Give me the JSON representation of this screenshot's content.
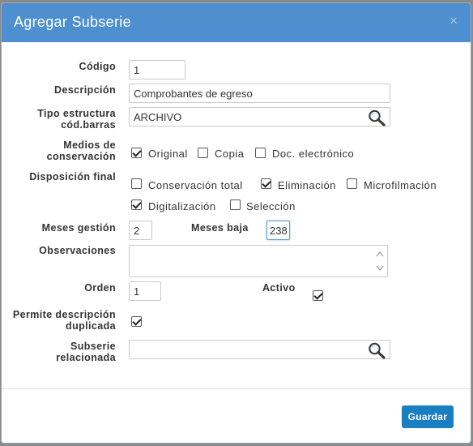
{
  "modal": {
    "title": "Agregar Subserie",
    "close_label": "×"
  },
  "fields": {
    "codigo": {
      "label": "Código",
      "value": "1"
    },
    "descripcion": {
      "label": "Descripción",
      "value": "Comprobantes de egreso"
    },
    "tipo_estructura": {
      "label_line1": "Tipo estructura",
      "label_line2": "cód.barras",
      "value": "ARCHIVO"
    },
    "medios": {
      "label_line1": "Medios de",
      "label_line2": "conservación",
      "options": [
        {
          "label": "Original",
          "checked": true
        },
        {
          "label": "Copia",
          "checked": false
        },
        {
          "label": "Doc. electrónico",
          "checked": false
        }
      ]
    },
    "disposicion": {
      "label": "Disposición final",
      "options": [
        {
          "label": "Conservación total",
          "checked": false
        },
        {
          "label": "Eliminación",
          "checked": true
        },
        {
          "label": "Microfilmación",
          "checked": false
        },
        {
          "label": "Digitalización",
          "checked": true
        },
        {
          "label": "Selección",
          "checked": false
        }
      ]
    },
    "meses_gestion": {
      "label": "Meses gestión",
      "value": "2"
    },
    "meses_baja": {
      "label": "Meses baja",
      "value": "238"
    },
    "observaciones": {
      "label": "Observaciones",
      "value": ""
    },
    "orden": {
      "label": "Orden",
      "value": "1"
    },
    "activo": {
      "label": "Activo",
      "checked": true
    },
    "permite_desc": {
      "label_line1": "Permite descripción",
      "label_line2": "duplicada",
      "checked": true
    },
    "subserie_rel": {
      "label_line1": "Subserie",
      "label_line2": "relacionada",
      "value": ""
    }
  },
  "footer": {
    "save_label": "Guardar"
  },
  "colors": {
    "header": "#4e8fcf",
    "primary_button": "#1a7fc1"
  }
}
